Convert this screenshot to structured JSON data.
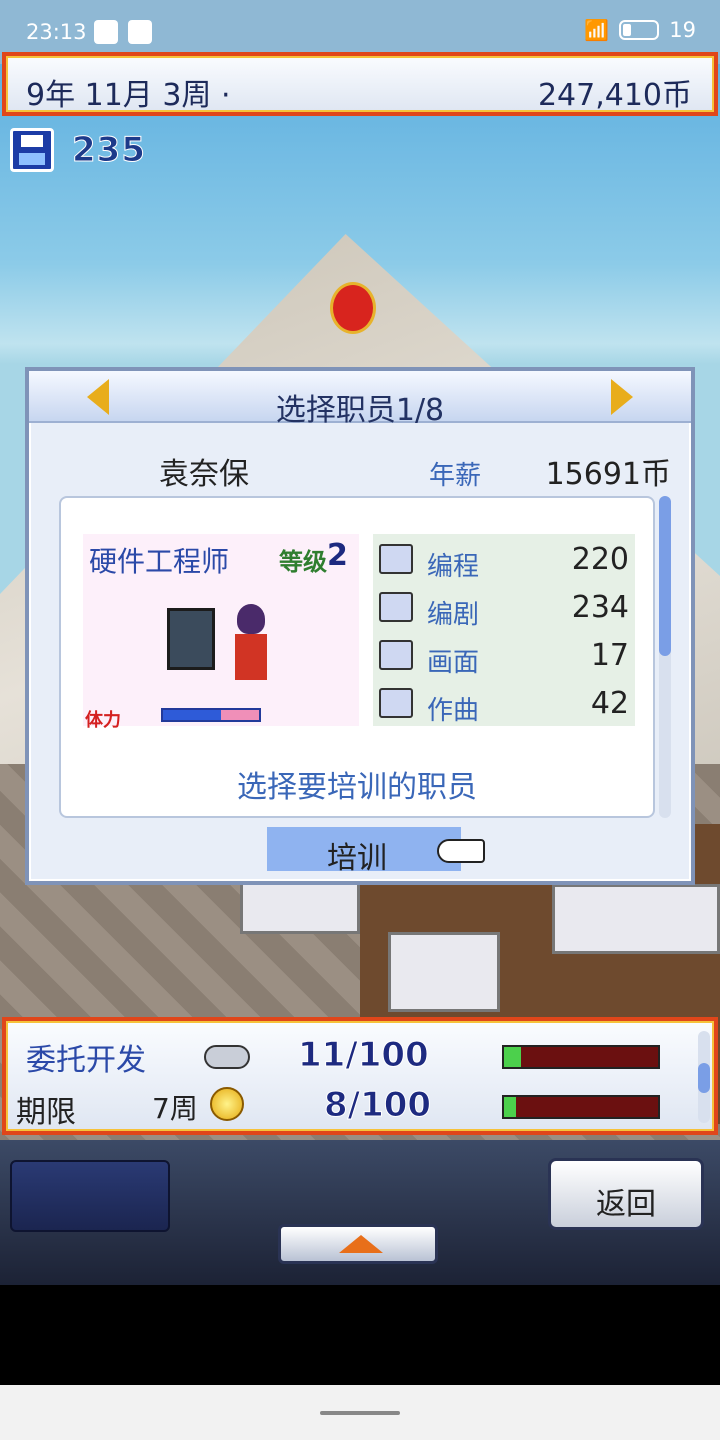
{
  "status_bar": {
    "time": "23:13",
    "battery": "19"
  },
  "hud": {
    "date": "9年 11月 3周 ·",
    "money": "247,410币"
  },
  "save": {
    "count": "235"
  },
  "dialog": {
    "title": "选择职员1/8",
    "employee": {
      "name": "袁奈保",
      "salary_label": "年薪",
      "salary": "15691币"
    },
    "card": {
      "job": "硬件工程师",
      "level_label": "等级",
      "level": "2",
      "stamina_label": "体力",
      "stamina_fraction": 0.6
    },
    "stats": [
      {
        "icon": "computer-icon",
        "name": "编程",
        "value": "220"
      },
      {
        "icon": "book-icon",
        "name": "编剧",
        "value": "234"
      },
      {
        "icon": "paint-icon",
        "name": "画面",
        "value": "17"
      },
      {
        "icon": "music-icon",
        "name": "作曲",
        "value": "42"
      }
    ],
    "hint": "选择要培训的职员",
    "button": "培训"
  },
  "project": {
    "title": "委托开发",
    "deadline_label": "期限",
    "weeks": "7周",
    "progress1": "11/100",
    "progress2": "8/100",
    "bar1_fraction": 0.11,
    "bar2_fraction": 0.08
  },
  "controls": {
    "back": "返回"
  }
}
